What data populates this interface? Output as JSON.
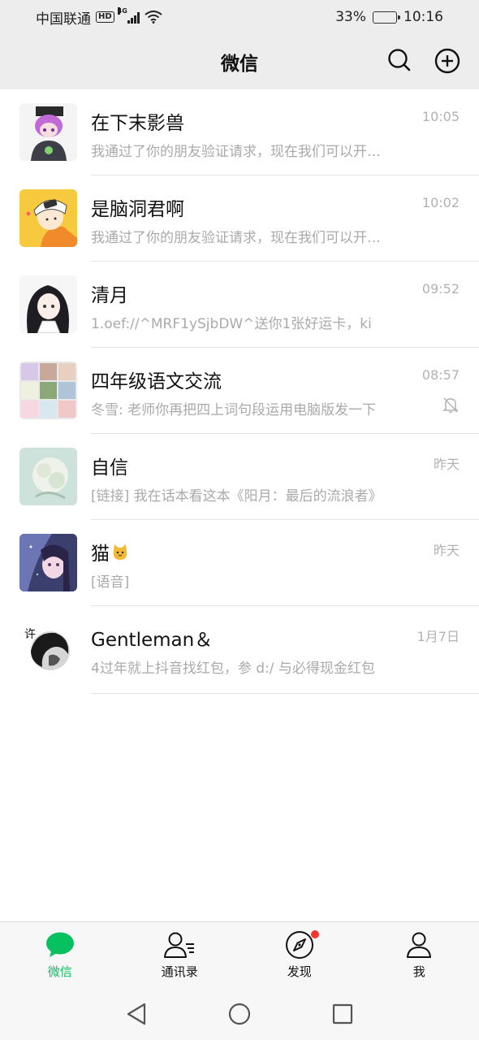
{
  "status_bar": {
    "carrier": "中国联通",
    "hd": "HD",
    "network": "4G",
    "battery_percent": "33%",
    "battery_level": 0.33,
    "time": "10:16"
  },
  "header": {
    "title": "微信"
  },
  "chats": [
    {
      "name": "在下末影兽",
      "time": "10:05",
      "preview": "我通过了你的朋友验证请求，现在我们可以开始聊天了",
      "muted": false
    },
    {
      "name": "是脑洞君啊",
      "time": "10:02",
      "preview": "我通过了你的朋友验证请求，现在我们可以开始聊天了",
      "muted": false
    },
    {
      "name": "清月",
      "time": "09:52",
      "preview": "1.oef://^MRF1ySjbDW^送你1张好运卡，ki",
      "muted": false
    },
    {
      "name": "四年级语文交流",
      "time": "08:57",
      "preview": "冬雪: 老师你再把四上词句段运用电脑版发一下",
      "muted": true
    },
    {
      "name": "自信",
      "time": "昨天",
      "preview": "[链接] 我在话本看这本《阳月：最后的流浪者》",
      "muted": false
    },
    {
      "name": "猫",
      "time": "昨天",
      "preview": "[语音]",
      "muted": false
    },
    {
      "name": "Gentleman＆",
      "time": "1月7日",
      "preview": "4过年就上抖音找红包，参 d:/ 与必得现金红包",
      "muted": false
    }
  ],
  "tabs": [
    {
      "label": "微信",
      "icon": "chat-bubble-icon",
      "active": true
    },
    {
      "label": "通讯录",
      "icon": "contacts-icon",
      "active": false
    },
    {
      "label": "发现",
      "icon": "compass-icon",
      "active": false,
      "badge_dot": true
    },
    {
      "label": "我",
      "icon": "person-icon",
      "active": false
    }
  ],
  "colors": {
    "accent": "#07c160",
    "header_bg": "#ededed",
    "badge_red": "#f43530"
  }
}
